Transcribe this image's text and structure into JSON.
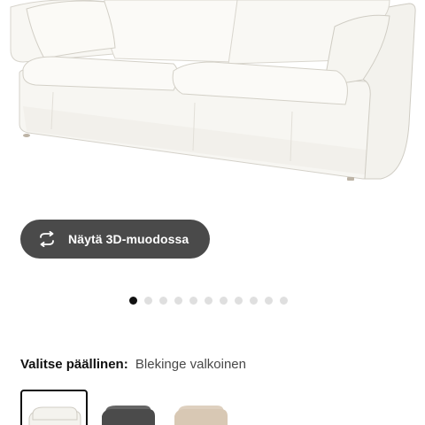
{
  "product_image": {
    "description_icon": "sofa-image",
    "colors": {
      "fabric": "#f6f5f0",
      "shadow": "#e4e2db",
      "outline": "#c9c6bd",
      "leg": "#bdb4a6"
    }
  },
  "view3d_button": {
    "label": "Näytä 3D-muodossa",
    "icon": "rotate-3d-icon",
    "background": "#4a4a4a"
  },
  "carousel": {
    "total": 11,
    "active_index": 0,
    "active_color": "#111111",
    "inactive_color": "#dfdfdf"
  },
  "cover_selector": {
    "label": "Valitse päällinen:",
    "value": "Blekinge valkoinen",
    "options": [
      {
        "color": "#f4f3ee",
        "selected": true
      },
      {
        "color": "#4b4b4b",
        "selected": false
      },
      {
        "color": "#d8c8b4",
        "selected": false
      }
    ]
  }
}
